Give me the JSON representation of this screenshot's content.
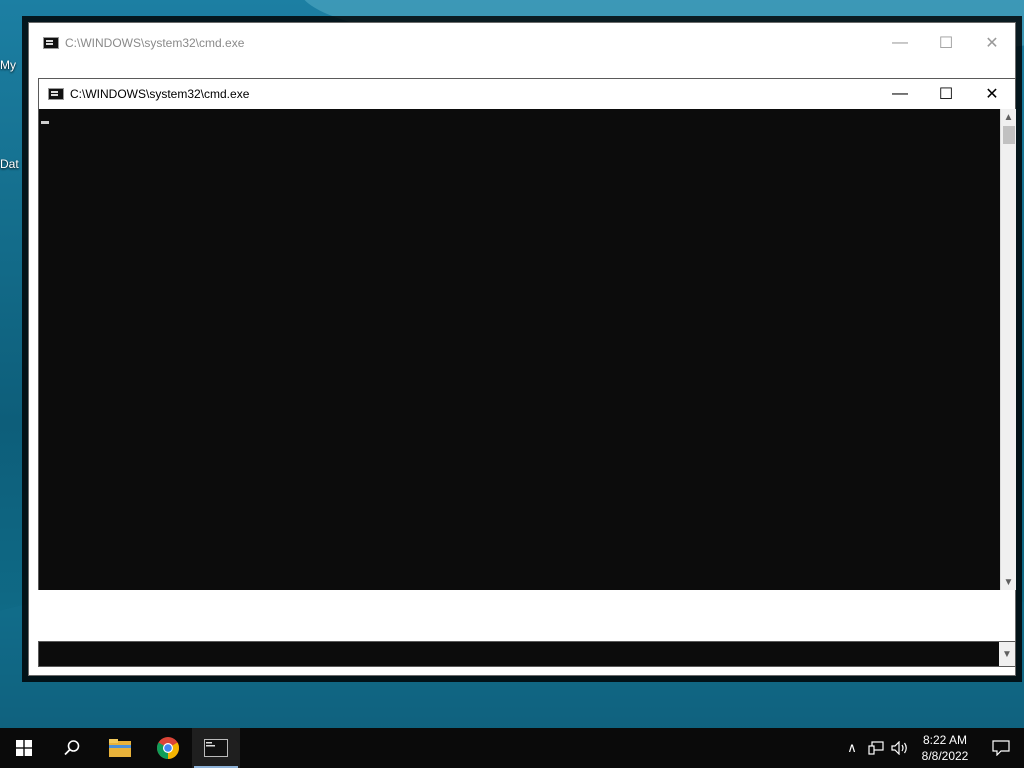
{
  "desktop": {
    "icons": [
      {
        "label": "My"
      },
      {
        "label": "Dat"
      }
    ]
  },
  "back_window": {
    "title": "C:\\WINDOWS\\system32\\cmd.exe",
    "minimize": "—",
    "maximize": "☐",
    "close": "✕"
  },
  "front_window": {
    "title": "C:\\WINDOWS\\system32\\cmd.exe",
    "minimize": "—",
    "maximize": "☐",
    "close": "✕",
    "scroll_up": "▲",
    "scroll_down": "▼"
  },
  "taskbar": {
    "start_icon": "windows-logo-icon",
    "search_icon": "search-icon",
    "apps": [
      {
        "name": "file-explorer-icon"
      },
      {
        "name": "chrome-icon"
      },
      {
        "name": "cmd-icon",
        "active": true
      }
    ],
    "tray": {
      "chevron": "∧",
      "time": "8:22 AM",
      "date": "8/8/2022"
    }
  },
  "colors": {
    "console_bg": "#0c0c0c",
    "taskbar_bg": "#0a0a0a",
    "desktop_accent": "#1c7fa3"
  }
}
